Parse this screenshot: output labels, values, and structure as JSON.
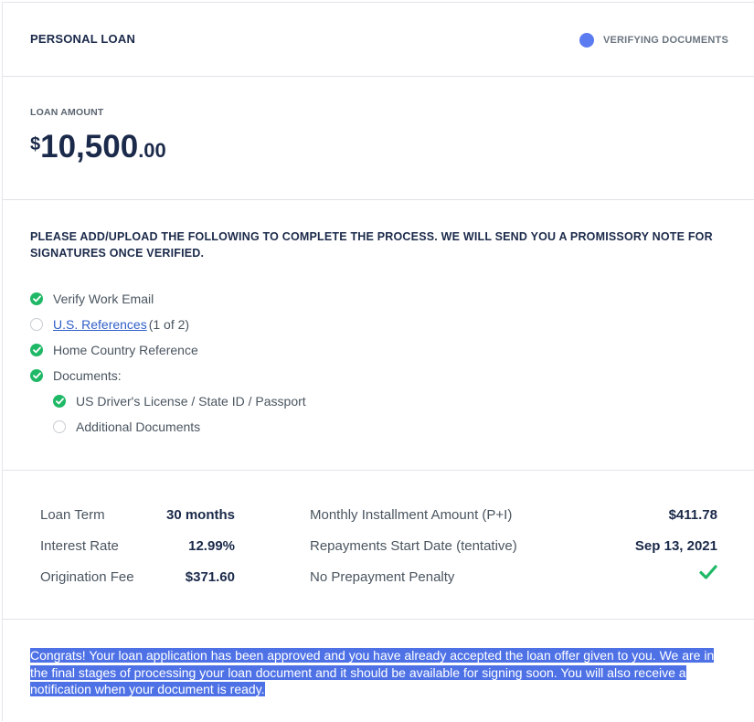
{
  "header": {
    "title": "PERSONAL LOAN",
    "status": "VERIFYING DOCUMENTS",
    "status_color": "#5b7cf0"
  },
  "loan": {
    "label": "LOAN AMOUNT",
    "currency": "$",
    "amount": "10,500",
    "cents": ".00"
  },
  "requirements": {
    "instruction": "PLEASE ADD/UPLOAD THE FOLLOWING TO COMPLETE THE PROCESS. WE WILL SEND YOU A PROMISSORY NOTE FOR SIGNATURES ONCE VERIFIED.",
    "items": [
      {
        "label": "Verify Work Email",
        "status": "done"
      },
      {
        "label": "U.S. References",
        "count": "(1 of 2)",
        "status": "pending",
        "link": true
      },
      {
        "label": "Home Country Reference",
        "status": "done"
      },
      {
        "label": "Documents:",
        "status": "done"
      },
      {
        "label": "US Driver's License / State ID / Passport",
        "status": "done",
        "sub": true
      },
      {
        "label": "Additional Documents",
        "status": "pending",
        "sub": true
      }
    ]
  },
  "terms": {
    "loan_term_label": "Loan Term",
    "loan_term_value": "30 months",
    "interest_rate_label": "Interest Rate",
    "interest_rate_value": "12.99%",
    "origination_fee_label": "Origination Fee",
    "origination_fee_value": "$371.60",
    "monthly_label": "Monthly Installment Amount (P+I)",
    "monthly_value": "$411.78",
    "start_label": "Repayments Start Date (tentative)",
    "start_value": "Sep 13, 2021",
    "prepay_label": "No Prepayment Penalty",
    "prepay_icon": "checkmark-icon"
  },
  "message": "Congrats! Your loan application has been approved and you have already accepted the loan offer given to you. We are in the final stages of processing your loan document and it should be available for signing soon. You will also receive a notification when your document is ready.",
  "colors": {
    "check": "#1fb866",
    "highlight": "#4e72e6",
    "link": "#2f5ec8"
  }
}
